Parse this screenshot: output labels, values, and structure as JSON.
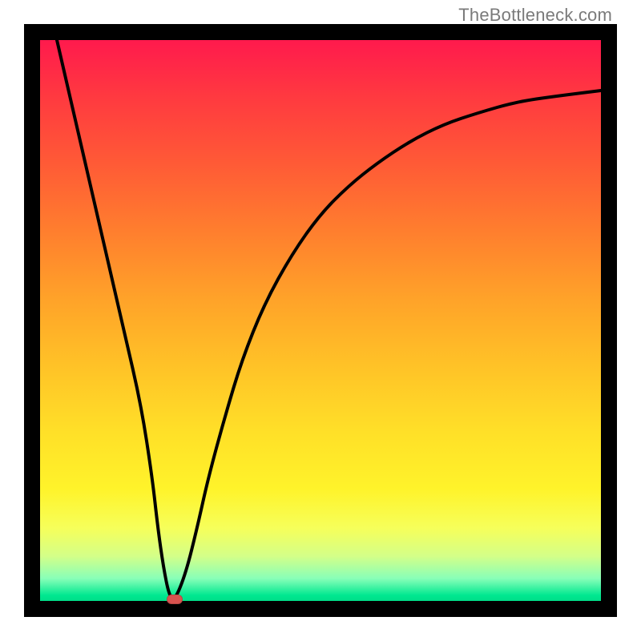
{
  "attribution": "TheBottleneck.com",
  "chart_data": {
    "type": "line",
    "title": "",
    "xlabel": "",
    "ylabel": "",
    "xlim": [
      0,
      100
    ],
    "ylim": [
      0,
      100
    ],
    "grid": false,
    "legend": false,
    "series": [
      {
        "name": "curve",
        "x": [
          3,
          6,
          9,
          12,
          15,
          18,
          20,
          21,
          22,
          23,
          24,
          26,
          28,
          30,
          33,
          36,
          40,
          45,
          50,
          55,
          60,
          66,
          72,
          78,
          85,
          92,
          100
        ],
        "y": [
          100,
          87,
          74,
          61,
          48,
          35,
          22,
          13,
          6,
          1,
          0,
          5,
          13,
          22,
          33,
          43,
          53,
          62,
          69,
          74,
          78,
          82,
          85,
          87,
          89,
          90,
          91
        ]
      }
    ],
    "minimum_point": {
      "x": 24,
      "y": 0
    },
    "background_gradient": {
      "orientation": "vertical",
      "stops": [
        {
          "pos": 0.0,
          "color": "#ff1a4d"
        },
        {
          "pos": 0.25,
          "color": "#ff6a30"
        },
        {
          "pos": 0.55,
          "color": "#ffc227"
        },
        {
          "pos": 0.8,
          "color": "#fff32a"
        },
        {
          "pos": 0.93,
          "color": "#c8ff90"
        },
        {
          "pos": 1.0,
          "color": "#00dd88"
        }
      ]
    },
    "marker_color": "#d9534f",
    "curve_color": "#000000"
  }
}
